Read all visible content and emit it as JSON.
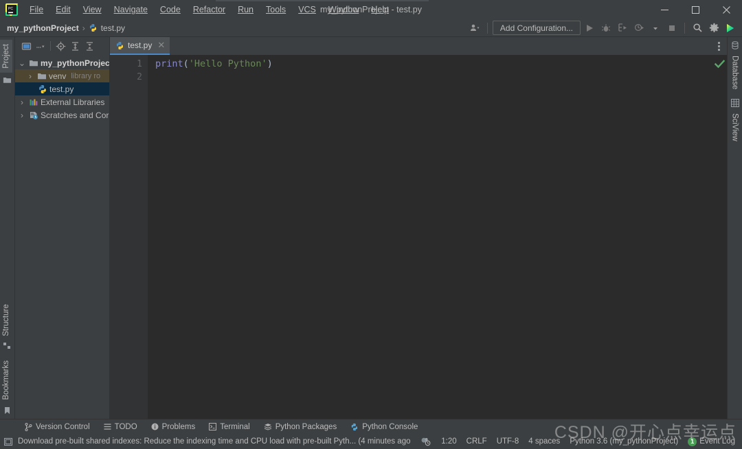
{
  "window": {
    "title": "my_pythonProject - test.py",
    "minimize_label": "—",
    "maximize_label": "□",
    "close_label": "✕"
  },
  "menubar": {
    "items": [
      {
        "label": "File"
      },
      {
        "label": "Edit"
      },
      {
        "label": "View"
      },
      {
        "label": "Navigate"
      },
      {
        "label": "Code"
      },
      {
        "label": "Refactor"
      },
      {
        "label": "Run"
      },
      {
        "label": "Tools"
      },
      {
        "label": "VCS"
      },
      {
        "label": "Window"
      },
      {
        "label": "Help"
      }
    ]
  },
  "breadcrumb": {
    "project": "my_pythonProject",
    "separator": "›",
    "file": "test.py"
  },
  "toolbar": {
    "add_configuration": "Add Configuration...",
    "icons": [
      "user-account-icon",
      "run-icon",
      "debug-icon",
      "run-coverage-icon",
      "profile-icon",
      "dropdown-icon",
      "stop-icon",
      "search-icon",
      "settings-gear-icon",
      "pycharm-badge-icon"
    ]
  },
  "left_rail": {
    "top": [
      {
        "label": "Project",
        "icon": "folder-icon",
        "active": true
      }
    ],
    "bottom": [
      {
        "label": "Structure",
        "icon": "structure-icon"
      },
      {
        "label": "Bookmarks",
        "icon": "bookmark-icon"
      }
    ]
  },
  "right_rail": {
    "items": [
      {
        "label": "Database",
        "icon": "database-icon"
      },
      {
        "label": "SciView",
        "icon": "grid-icon"
      }
    ]
  },
  "project_panel": {
    "toolbar_icons": [
      "view-mode-icon",
      "dropdown-icon",
      "locate-target-icon",
      "expand-all-icon",
      "collapse-all-icon"
    ],
    "tree": [
      {
        "label": "my_pythonProject",
        "icon": "folder-icon",
        "arrow": "⌄",
        "expanded": true,
        "bold": true,
        "indent": 0,
        "state": "none",
        "sub": ""
      },
      {
        "label": "venv",
        "icon": "folder-icon",
        "arrow": "›",
        "expanded": false,
        "bold": false,
        "indent": 1,
        "state": "venv",
        "sub": "library ro"
      },
      {
        "label": "test.py",
        "icon": "python-file-icon",
        "arrow": "",
        "expanded": false,
        "bold": false,
        "indent": 2,
        "state": "selected",
        "sub": ""
      },
      {
        "label": "External Libraries",
        "icon": "library-icon",
        "arrow": "›",
        "expanded": false,
        "bold": false,
        "indent": 0,
        "state": "none",
        "sub": ""
      },
      {
        "label": "Scratches and Cor",
        "icon": "scratch-icon",
        "arrow": "›",
        "expanded": false,
        "bold": false,
        "indent": 0,
        "state": "none",
        "sub": ""
      }
    ]
  },
  "editor": {
    "tab": {
      "label": "test.py",
      "icon": "python-file-icon",
      "close": "✕"
    },
    "line_numbers": [
      "1",
      "2"
    ],
    "code_line_1": {
      "fn": "print",
      "open_paren": "(",
      "string": "'Hello Python'",
      "close_paren": ")"
    },
    "inspection_status": "check-ok-icon"
  },
  "tool_windows": [
    {
      "label": "Version Control",
      "icon": "branch-icon"
    },
    {
      "label": "TODO",
      "icon": "list-icon"
    },
    {
      "label": "Problems",
      "icon": "info-icon"
    },
    {
      "label": "Terminal",
      "icon": "terminal-icon"
    },
    {
      "label": "Python Packages",
      "icon": "packages-icon"
    },
    {
      "label": "Python Console",
      "icon": "python-console-icon"
    }
  ],
  "status_bar": {
    "message": "Download pre-built shared indexes: Reduce the indexing time and CPU load with pre-built Pyth... (4 minutes ago",
    "message_icon": "window-icon",
    "caret_position": "1:20",
    "line_separator": "CRLF",
    "encoding": "UTF-8",
    "indent": "4 spaces",
    "interpreter": "Python 3.6 (my_pythonProject)",
    "event_log": "Event Log",
    "event_log_count": "1",
    "inspection_icon": "inspection-icon"
  },
  "watermark": {
    "text": "CSDN @开心点幸运点",
    "sub": ""
  },
  "colors": {
    "panel_bg": "#3c3f41",
    "editor_bg": "#2b2b2b",
    "gutter_bg": "#313335",
    "selection": "#0d293e",
    "venv_highlight": "#4e4631",
    "tab_active_underline": "#4a88c7",
    "string_green": "#6a8759",
    "keyword_purple": "#8888c6",
    "text": "#bbbbbb",
    "badge_green": "#499c54"
  }
}
